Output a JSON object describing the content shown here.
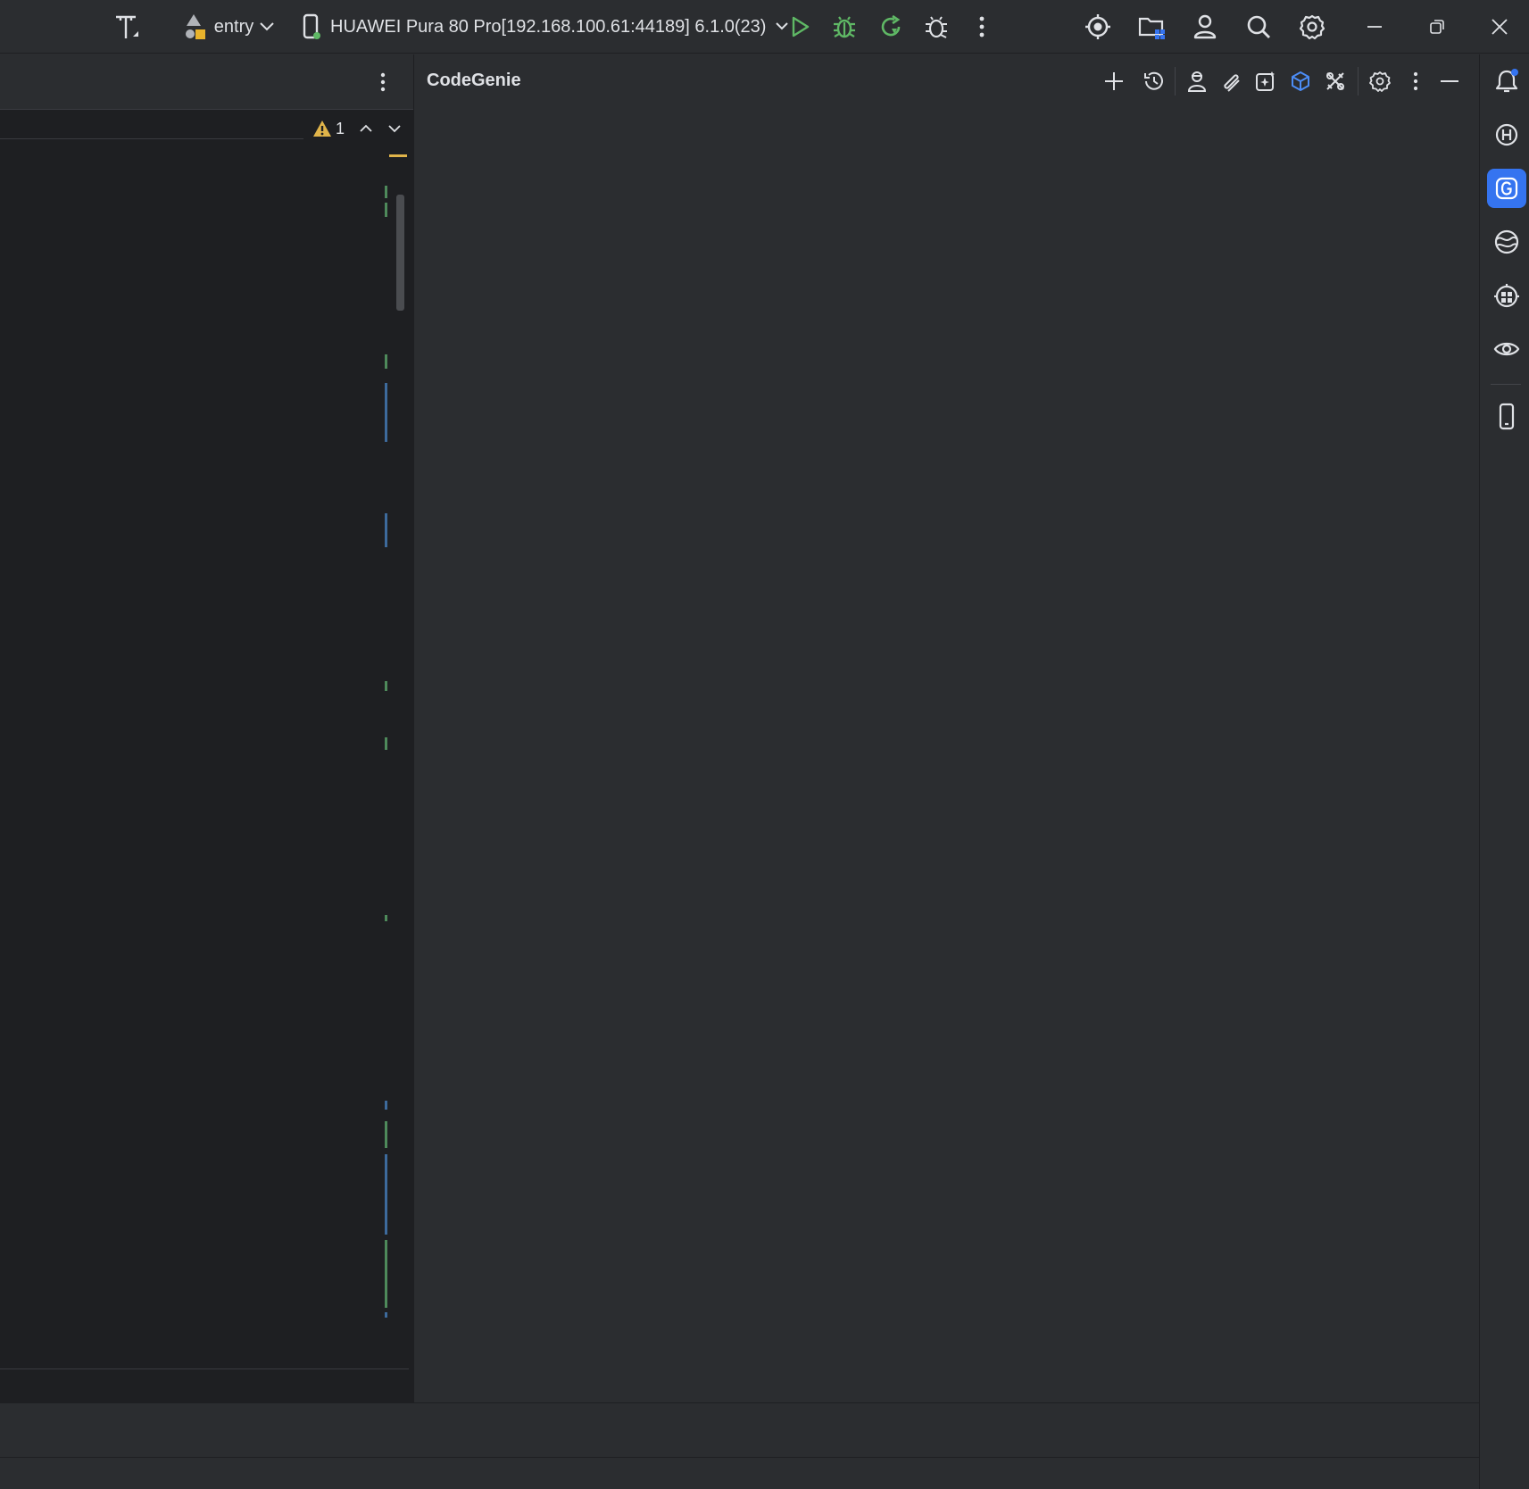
{
  "toolbar": {
    "module_label": "entry",
    "device_label": "HUAWEI Pura 80 Pro[192.168.100.61:44189] 6.1.0(23)"
  },
  "editor": {
    "warning_count": "1"
  },
  "codegenie": {
    "title": "CodeGenie"
  },
  "colors": {
    "background": "#2b2d30",
    "editor_background": "#1e1f22",
    "run_green": "#5fb865",
    "accent_blue": "#3574f0",
    "warning_yellow": "#e0b44a",
    "marker_green": "#4e8a5b",
    "marker_blue": "#3d6a9c"
  },
  "icons": {
    "titlebar": [
      "build-hammer-icon",
      "module-shapes-icon",
      "chevron-down-icon",
      "phone-icon",
      "run-icon",
      "debug-icon",
      "apply-changes-icon",
      "profiler-icon",
      "more-icon",
      "locate-icon",
      "device-file-icon",
      "account-icon",
      "search-icon",
      "settings-icon",
      "minimize-icon",
      "restore-icon",
      "close-icon"
    ],
    "codegenie": [
      "new-chat-icon",
      "history-icon",
      "agent-icon",
      "attach-icon",
      "generate-icon",
      "cube-icon",
      "tools-icon",
      "settings-icon",
      "more-icon",
      "hide-icon"
    ],
    "sidebar": [
      "notifications-icon",
      "harmony-h-icon",
      "codegenie-g-icon",
      "globe-icon",
      "robot-icon",
      "preview-eye-icon",
      "device-phone-icon"
    ]
  }
}
